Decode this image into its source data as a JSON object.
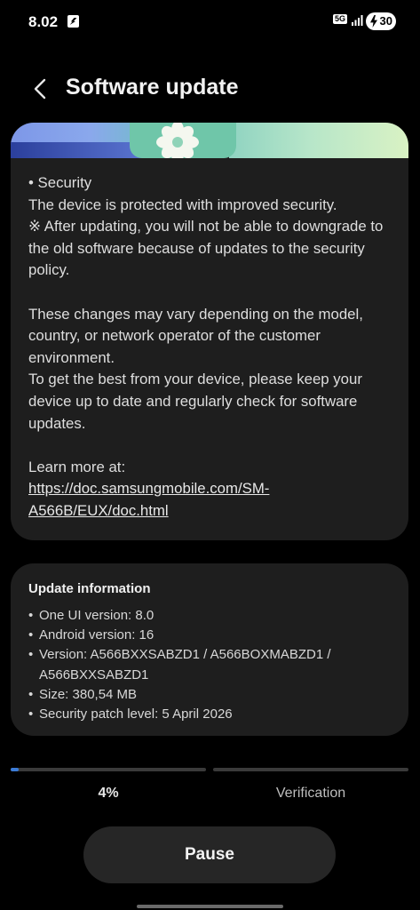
{
  "status_bar": {
    "time": "8.02",
    "network": "5G",
    "battery": "30"
  },
  "header": {
    "back_icon": "chevron-left-icon",
    "title": "Software update"
  },
  "release_notes": {
    "banner_icon": "flower-icon",
    "paragraphs": [
      "• Security",
      "The device is protected with improved security.",
      "※ After updating, you will not be able to downgrade to the old software because of updates to the security policy.",
      "",
      "These changes may vary depending on the model, country, or network operator of the customer environment.",
      "To get the best from your device, please keep your device up to date and regularly check for software updates.",
      "",
      "Learn more at:"
    ],
    "link": "https://doc.samsungmobile.com/SM-A566B/EUX/doc.html"
  },
  "update_info": {
    "title": "Update information",
    "items": [
      "One UI version: 8.0",
      "Android version: 16",
      "Version: A566BXXSABZD1 / A566BOXMABZD1 / A566BXXSABZD1",
      "Size: 380,54 MB",
      "Security patch level: 5 April 2026"
    ]
  },
  "progress": {
    "download_fraction": 0.04,
    "percent_label": "4%",
    "verification_label": "Verification",
    "accent_color": "#3b7bd6"
  },
  "actions": {
    "pause_label": "Pause"
  }
}
